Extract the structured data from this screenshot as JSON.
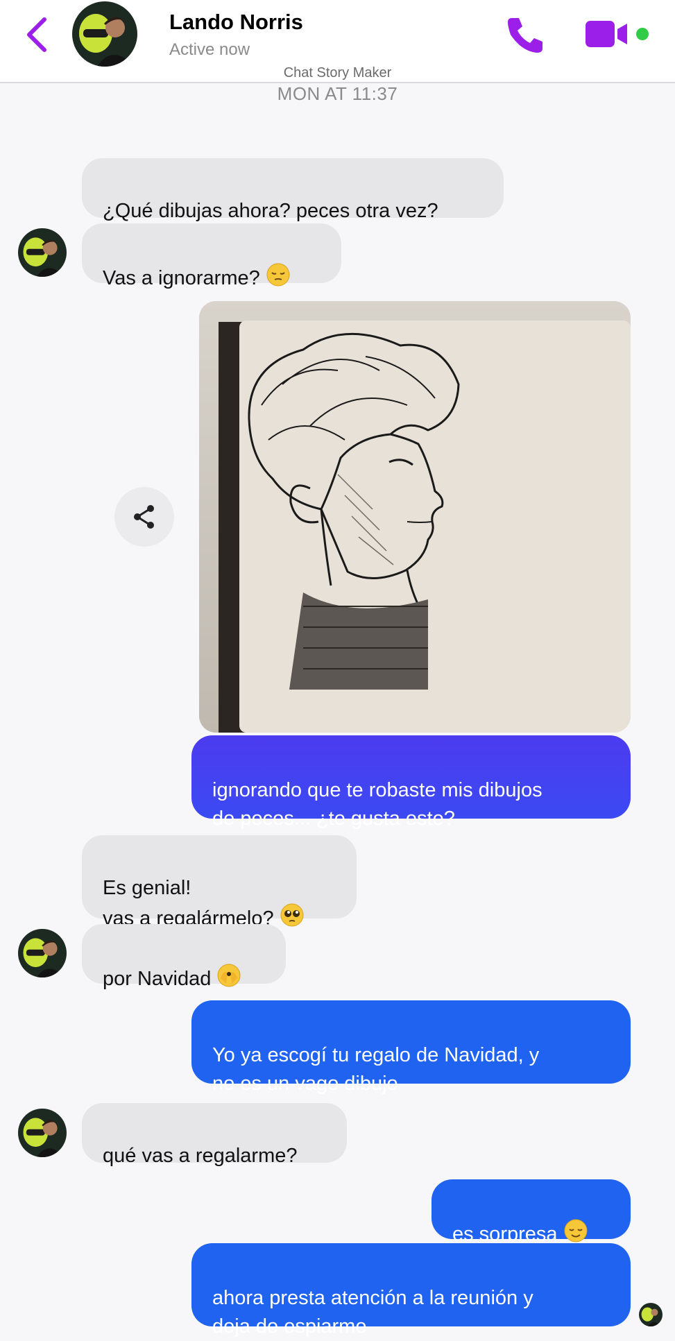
{
  "header": {
    "contact_name": "Lando Norris",
    "status": "Active now",
    "icons": [
      "back-chevron-icon",
      "phone-icon",
      "video-camera-icon",
      "online-dot-icon"
    ],
    "accent_color": "#9b1fe8",
    "online_color": "#31cc46"
  },
  "watermark": "Chat Story Maker",
  "timestamp": "MON AT 11:37",
  "colors": {
    "incoming_bubble": "#e6e6e8",
    "outgoing_gradient_top": "#4c3bf0",
    "outgoing_blue": "#1f63f0"
  },
  "messages": [
    {
      "from": "contact",
      "text": "¿Qué dibujas ahora? peces otra vez?"
    },
    {
      "from": "contact",
      "text": "Vas a ignorarme? ",
      "emoji": "pensive-face"
    },
    {
      "from": "me",
      "type": "image",
      "content": "pen sketch portrait"
    },
    {
      "from": "me",
      "text": "ignorando que te robaste mis dibujos\nde peces... ¿te gusta este?"
    },
    {
      "from": "contact",
      "text": "Es genial!\nvas a regalármelo? ",
      "emoji": "pleading-face"
    },
    {
      "from": "contact",
      "text": "por Navidad ",
      "emoji": "face-peeking-eye"
    },
    {
      "from": "me",
      "text": "Yo ya escogí tu regalo de Navidad, y\nno es un vago dibujo"
    },
    {
      "from": "contact",
      "text": "qué vas a regalarme?"
    },
    {
      "from": "me",
      "text": "es sorpresa ",
      "emoji": "relieved-face"
    },
    {
      "from": "me",
      "text": "ahora presta atención a la reunión y\ndeja de espiarme"
    }
  ]
}
